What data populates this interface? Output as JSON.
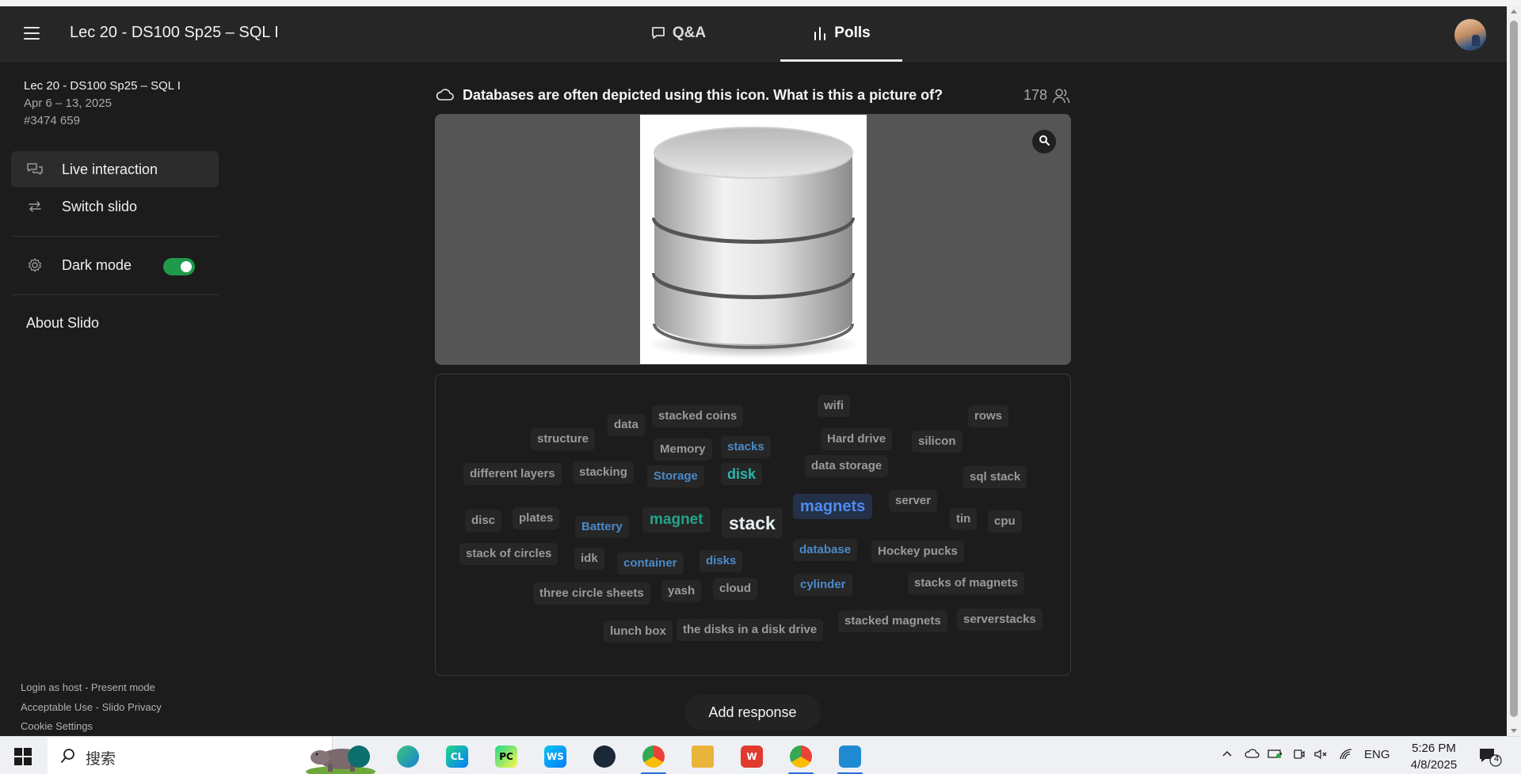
{
  "header": {
    "event_title": "Lec 20 - DS100 Sp25 – SQL I",
    "tabs": [
      {
        "label": "Q&A",
        "icon": "chat-bubble-icon"
      },
      {
        "label": "Polls",
        "icon": "bar-chart-icon",
        "active": true
      }
    ]
  },
  "sidebar": {
    "event_name": "Lec 20 - DS100 Sp25 – SQL I",
    "event_dates": "Apr 6 – 13, 2025",
    "event_code": "#3474 659",
    "items": [
      {
        "label": "Live interaction",
        "icon": "chat-bubbles-icon",
        "active": true
      },
      {
        "label": "Switch slido",
        "icon": "swap-arrows-icon"
      }
    ],
    "dark_mode_label": "Dark mode",
    "dark_mode_on": true,
    "about_label": "About Slido",
    "footer": {
      "login_host": "Login as host",
      "separator": " - ",
      "present_mode": "Present mode",
      "acceptable_use": "Acceptable Use",
      "privacy": "Slido Privacy",
      "cookie_settings": "Cookie Settings"
    }
  },
  "poll": {
    "question": "Databases are often depicted using this icon. What is this a picture of?",
    "participant_count": "178",
    "image_alt": "database-cylinder-icon",
    "add_response_label": "Add response",
    "words": [
      {
        "text": "wifi",
        "style": "grey"
      },
      {
        "text": "rows",
        "style": "grey"
      },
      {
        "text": "data",
        "style": "grey"
      },
      {
        "text": "stacked coins",
        "style": "grey"
      },
      {
        "text": "structure",
        "style": "grey"
      },
      {
        "text": "Hard drive",
        "style": "grey"
      },
      {
        "text": "silicon",
        "style": "grey"
      },
      {
        "text": "Memory",
        "style": "grey"
      },
      {
        "text": "stacks",
        "style": "blue"
      },
      {
        "text": "different layers",
        "style": "grey"
      },
      {
        "text": "stacking",
        "style": "grey"
      },
      {
        "text": "Storage",
        "style": "blue"
      },
      {
        "text": "disk",
        "style": "teal"
      },
      {
        "text": "data storage",
        "style": "grey"
      },
      {
        "text": "sql stack",
        "style": "grey"
      },
      {
        "text": "magnets",
        "style": "bright"
      },
      {
        "text": "server",
        "style": "grey"
      },
      {
        "text": "disc",
        "style": "grey"
      },
      {
        "text": "plates",
        "style": "grey"
      },
      {
        "text": "Battery",
        "style": "blue"
      },
      {
        "text": "magnet",
        "style": "green"
      },
      {
        "text": "stack",
        "style": "white"
      },
      {
        "text": "tin",
        "style": "grey"
      },
      {
        "text": "cpu",
        "style": "grey"
      },
      {
        "text": "stack of circles",
        "style": "grey"
      },
      {
        "text": "idk",
        "style": "grey"
      },
      {
        "text": "container",
        "style": "blue"
      },
      {
        "text": "disks",
        "style": "blue"
      },
      {
        "text": "database",
        "style": "blue"
      },
      {
        "text": "Hockey pucks",
        "style": "grey"
      },
      {
        "text": "cylinder",
        "style": "blue"
      },
      {
        "text": "stacks of magnets",
        "style": "grey"
      },
      {
        "text": "three circle sheets",
        "style": "grey"
      },
      {
        "text": "yash",
        "style": "grey"
      },
      {
        "text": "cloud",
        "style": "grey"
      },
      {
        "text": "stacked magnets",
        "style": "grey"
      },
      {
        "text": "serverstacks",
        "style": "grey"
      },
      {
        "text": "lunch box",
        "style": "grey"
      },
      {
        "text": "the disks in a disk drive",
        "style": "grey"
      }
    ]
  },
  "taskbar": {
    "search_placeholder": "搜索",
    "apps": [
      {
        "name": "brain-app-icon",
        "abbr": "",
        "color": "#0d6e6e"
      },
      {
        "name": "edge-browser-icon",
        "abbr": "",
        "color": "#1a7fd4"
      },
      {
        "name": "clion-icon",
        "abbr": "CL",
        "color": "#1fae6e"
      },
      {
        "name": "pycharm-icon",
        "abbr": "PC",
        "color": "#1ab34f"
      },
      {
        "name": "webstorm-icon",
        "abbr": "WS",
        "color": "#1a6ff0"
      },
      {
        "name": "steam-icon",
        "abbr": "",
        "color": "#1b2838"
      },
      {
        "name": "chrome-icon",
        "abbr": "",
        "color": "#e3a21a",
        "active": true
      },
      {
        "name": "file-explorer-icon",
        "abbr": "",
        "color": "#e8b43a"
      },
      {
        "name": "wps-office-icon",
        "abbr": "W",
        "color": "#e03a2e"
      },
      {
        "name": "chrome-profile-icon",
        "abbr": "",
        "color": "#d64b3b",
        "active": true
      },
      {
        "name": "vscode-icon",
        "abbr": "",
        "color": "#1f8ad2",
        "active": true
      }
    ],
    "language": "ENG",
    "time": "5:26 PM",
    "date": "4/8/2025",
    "notification_count": "4"
  }
}
